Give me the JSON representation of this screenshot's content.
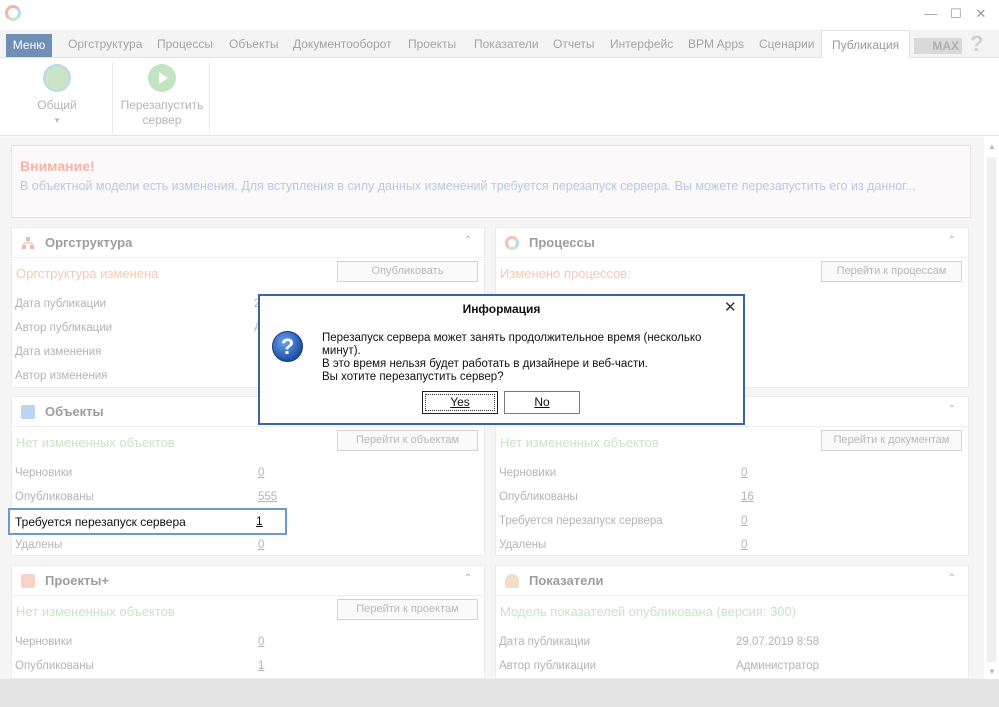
{
  "window": {
    "minimize_glyph": "—",
    "maximize_glyph": "☐",
    "close_glyph": "✕"
  },
  "menubar": {
    "menu_label": "Меню",
    "tabs": [
      "Оргструктура",
      "Процессы",
      "Объекты",
      "Документооборот",
      "Проекты",
      "Показатели",
      "Отчеты",
      "Интерфейс",
      "BPM Apps",
      "Сценарии",
      "Публикация"
    ],
    "active_tab": "Публикация",
    "badge": "MAX",
    "help": "?"
  },
  "ribbon": {
    "general_label": "Общий",
    "general_arrow": "▾",
    "restart_label_line1": "Перезапустить",
    "restart_label_line2": "сервер"
  },
  "warning": {
    "title": "Внимание!",
    "text": "В объектной модели есть изменения. Для вступления в силу данных изменений требуется перезапуск сервера. Вы можете перезапустить его из данног..."
  },
  "panels": {
    "orgstructure": {
      "title": "Оргструктура",
      "subtitle": "Оргструктура изменена",
      "button": "Опубликовать",
      "rows": [
        "Дата публикации",
        "Автор публикации",
        "Дата изменения",
        "Автор изменения"
      ],
      "values": [
        "2",
        "А",
        "",
        ""
      ]
    },
    "processes": {
      "title": "Процессы",
      "subtitle": "Изменено процессов:",
      "button": "Перейти к процессам"
    },
    "objects": {
      "title": "Объекты",
      "subtitle": "Нет измененных объектов",
      "button": "Перейти к объектам",
      "rows": [
        "Черновики",
        "Опубликованы",
        "Требуется перезапуск сервера",
        "Удалены"
      ],
      "values": [
        "0",
        "555",
        "1",
        "0"
      ]
    },
    "documents": {
      "subtitle": "Нет измененных объектов",
      "button": "Перейти к документам",
      "rows": [
        "Черновики",
        "Опубликованы",
        "Требуется перезапуск сервера",
        "Удалены"
      ],
      "values": [
        "0",
        "16",
        "0",
        "0"
      ]
    },
    "projects": {
      "title": "Проекты+",
      "subtitle": "Нет измененных объектов",
      "button": "Перейти к проектам",
      "rows": [
        "Черновики",
        "Опубликованы"
      ],
      "values": [
        "0",
        "1"
      ]
    },
    "indicators": {
      "title": "Показатели",
      "subtitle": "Модель показателей опубликована (версия: 300)",
      "rows": [
        "Дата публикации",
        "Автор публикации"
      ],
      "values": [
        "29.07.2019 8:58",
        "Администратор"
      ]
    }
  },
  "dialog": {
    "title": "Информация",
    "close": "✕",
    "icon": "?",
    "line1": "Перезапуск сервера может занять продолжительное время (несколько минут).",
    "line2": "В это время нельзя будет работать в дизайнере и веб-части.",
    "line3": "Вы хотите перезапустить сервер?",
    "yes": "Yes",
    "no": "No"
  },
  "colors": {
    "dialog_border": "#3864a6",
    "highlight_border": "#6b99c9",
    "menu_button": "#6f8fb5"
  }
}
